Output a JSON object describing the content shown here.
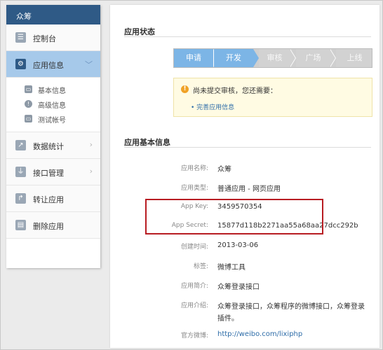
{
  "sidebar": {
    "header": "众筹",
    "items": [
      {
        "label": "控制台",
        "icon": "dashboard-icon",
        "glyph": "☰"
      },
      {
        "label": "应用信息",
        "icon": "gear-icon",
        "glyph": "⚙",
        "arrow": "﹀"
      },
      {
        "label": "数据统计",
        "icon": "chart-icon",
        "glyph": "↗",
        "arrow": "›"
      },
      {
        "label": "接口管理",
        "icon": "plug-icon",
        "glyph": "⏚",
        "arrow": "›"
      },
      {
        "label": "转让应用",
        "icon": "share-icon",
        "glyph": "↱"
      },
      {
        "label": "删除应用",
        "icon": "trash-icon",
        "glyph": "▤"
      }
    ],
    "subitems": [
      {
        "label": "基本信息",
        "icon": "card-icon",
        "glyph": "▭"
      },
      {
        "label": "高级信息",
        "icon": "info-icon",
        "glyph": "!"
      },
      {
        "label": "测试帐号",
        "icon": "id-card-icon",
        "glyph": "▭"
      }
    ]
  },
  "main": {
    "status_title": "应用状态",
    "steps": [
      "申请",
      "开发",
      "审核",
      "广场",
      "上线"
    ],
    "steps_done": 2,
    "notice": {
      "icon": "!",
      "text": "尚未提交审核，您还需要：",
      "link": "• 完善应用信息"
    },
    "basic_title": "应用基本信息",
    "fields": [
      {
        "key": "应用名称:",
        "value": "众筹"
      },
      {
        "key": "应用类型:",
        "value": "普通应用 - 网页应用"
      },
      {
        "key": "App Key:",
        "value": "3459570354"
      },
      {
        "key": "App Secret:",
        "value": "15877d118b2271aa55a68aa27dcc292b"
      },
      {
        "key": "创建时间:",
        "value": "2013-03-06"
      },
      {
        "key": "标签:",
        "value": "微博工具"
      },
      {
        "key": "应用简介:",
        "value": "众筹登录接口"
      },
      {
        "key": "应用介绍:",
        "value": "众筹登录接口，众筹程序的微博接口，众筹登录",
        "value2": "插件。"
      },
      {
        "key": "官方微博:",
        "value": "http://weibo.com/lixiphp"
      }
    ]
  },
  "colors": {
    "header": "#2f5a86",
    "active_nav": "#a6c9ea",
    "step_done": "#7cb5e6",
    "highlight_border": "#b81c22"
  }
}
